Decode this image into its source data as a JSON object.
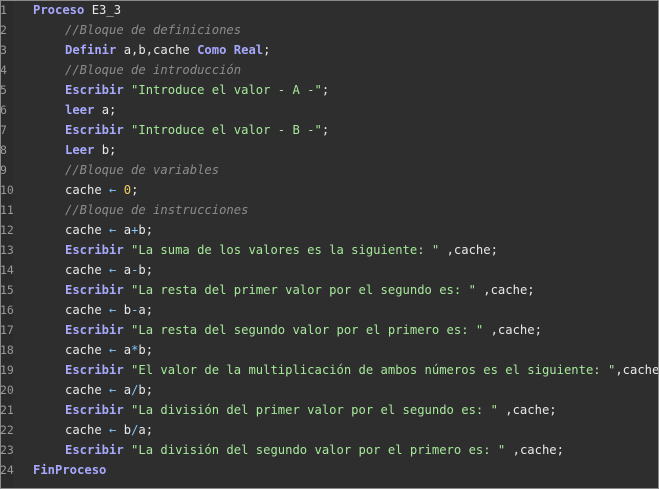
{
  "editor": {
    "lines": [
      {
        "n": "1",
        "indent": 0,
        "tokens": [
          {
            "t": "kw",
            "v": "Proceso"
          },
          {
            "t": "nm",
            "v": " E3_3"
          }
        ]
      },
      {
        "n": "2",
        "indent": 1,
        "tokens": [
          {
            "t": "cm",
            "v": "//Bloque de definiciones"
          }
        ]
      },
      {
        "n": "3",
        "indent": 1,
        "tokens": [
          {
            "t": "kw",
            "v": "Definir"
          },
          {
            "t": "nm",
            "v": " a,b,cache "
          },
          {
            "t": "kw",
            "v": "Como Real"
          },
          {
            "t": "pn",
            "v": ";"
          }
        ]
      },
      {
        "n": "4",
        "indent": 1,
        "tokens": [
          {
            "t": "cm",
            "v": "//Bloque de introducción"
          }
        ]
      },
      {
        "n": "5",
        "indent": 1,
        "tokens": [
          {
            "t": "kw",
            "v": "Escribir"
          },
          {
            "t": "nm",
            "v": " "
          },
          {
            "t": "st",
            "v": "\"Introduce el valor - A -\""
          },
          {
            "t": "pn",
            "v": ";"
          }
        ]
      },
      {
        "n": "6",
        "indent": 1,
        "tokens": [
          {
            "t": "kw",
            "v": "leer"
          },
          {
            "t": "nm",
            "v": " a;"
          }
        ]
      },
      {
        "n": "7",
        "indent": 1,
        "tokens": [
          {
            "t": "kw",
            "v": "Escribir"
          },
          {
            "t": "nm",
            "v": " "
          },
          {
            "t": "st",
            "v": "\"Introduce el valor - B -\""
          },
          {
            "t": "pn",
            "v": ";"
          }
        ]
      },
      {
        "n": "8",
        "indent": 1,
        "tokens": [
          {
            "t": "kw",
            "v": "Leer"
          },
          {
            "t": "nm",
            "v": " b;"
          }
        ]
      },
      {
        "n": "9",
        "indent": 1,
        "tokens": [
          {
            "t": "cm",
            "v": "//Bloque de variables"
          }
        ]
      },
      {
        "n": "10",
        "indent": 1,
        "tokens": [
          {
            "t": "nm",
            "v": "cache "
          },
          {
            "t": "op",
            "v": "←"
          },
          {
            "t": "nm",
            "v": " "
          },
          {
            "t": "nb",
            "v": "0"
          },
          {
            "t": "pn",
            "v": ";"
          }
        ]
      },
      {
        "n": "11",
        "indent": 1,
        "tokens": [
          {
            "t": "cm",
            "v": "//Bloque de instrucciones"
          }
        ]
      },
      {
        "n": "12",
        "indent": 1,
        "tokens": [
          {
            "t": "nm",
            "v": "cache "
          },
          {
            "t": "op",
            "v": "←"
          },
          {
            "t": "nm",
            "v": " a"
          },
          {
            "t": "op",
            "v": "+"
          },
          {
            "t": "nm",
            "v": "b;"
          }
        ]
      },
      {
        "n": "13",
        "indent": 1,
        "tokens": [
          {
            "t": "kw",
            "v": "Escribir"
          },
          {
            "t": "nm",
            "v": " "
          },
          {
            "t": "st",
            "v": "\"La suma de los valores es la siguiente: \""
          },
          {
            "t": "nm",
            "v": " ,cache;"
          }
        ]
      },
      {
        "n": "14",
        "indent": 1,
        "tokens": [
          {
            "t": "nm",
            "v": "cache "
          },
          {
            "t": "op",
            "v": "←"
          },
          {
            "t": "nm",
            "v": " a"
          },
          {
            "t": "op",
            "v": "-"
          },
          {
            "t": "nm",
            "v": "b;"
          }
        ]
      },
      {
        "n": "15",
        "indent": 1,
        "tokens": [
          {
            "t": "kw",
            "v": "Escribir"
          },
          {
            "t": "nm",
            "v": " "
          },
          {
            "t": "st",
            "v": "\"La resta del primer valor por el segundo es: \""
          },
          {
            "t": "nm",
            "v": " ,cache;"
          }
        ]
      },
      {
        "n": "16",
        "indent": 1,
        "tokens": [
          {
            "t": "nm",
            "v": "cache "
          },
          {
            "t": "op",
            "v": "←"
          },
          {
            "t": "nm",
            "v": " b"
          },
          {
            "t": "op",
            "v": "-"
          },
          {
            "t": "nm",
            "v": "a;"
          }
        ]
      },
      {
        "n": "17",
        "indent": 1,
        "tokens": [
          {
            "t": "kw",
            "v": "Escribir"
          },
          {
            "t": "nm",
            "v": " "
          },
          {
            "t": "st",
            "v": "\"La resta del segundo valor por el primero es: \""
          },
          {
            "t": "nm",
            "v": " ,cache;"
          }
        ]
      },
      {
        "n": "18",
        "indent": 1,
        "tokens": [
          {
            "t": "nm",
            "v": "cache "
          },
          {
            "t": "op",
            "v": "←"
          },
          {
            "t": "nm",
            "v": " a"
          },
          {
            "t": "op",
            "v": "*"
          },
          {
            "t": "nm",
            "v": "b;"
          }
        ]
      },
      {
        "n": "19",
        "indent": 1,
        "tokens": [
          {
            "t": "kw",
            "v": "Escribir"
          },
          {
            "t": "nm",
            "v": " "
          },
          {
            "t": "st",
            "v": "\"El valor de la multiplicación de ambos números es el siguiente: \""
          },
          {
            "t": "nm",
            "v": ",cache;"
          }
        ]
      },
      {
        "n": "20",
        "indent": 1,
        "tokens": [
          {
            "t": "nm",
            "v": "cache "
          },
          {
            "t": "op",
            "v": "←"
          },
          {
            "t": "nm",
            "v": " a"
          },
          {
            "t": "op",
            "v": "/"
          },
          {
            "t": "nm",
            "v": "b;"
          }
        ]
      },
      {
        "n": "21",
        "indent": 1,
        "tokens": [
          {
            "t": "kw",
            "v": "Escribir"
          },
          {
            "t": "nm",
            "v": " "
          },
          {
            "t": "st",
            "v": "\"La división del primer valor por el segundo es: \""
          },
          {
            "t": "nm",
            "v": " ,cache;"
          }
        ]
      },
      {
        "n": "22",
        "indent": 1,
        "tokens": [
          {
            "t": "nm",
            "v": "cache "
          },
          {
            "t": "op",
            "v": "←"
          },
          {
            "t": "nm",
            "v": " b"
          },
          {
            "t": "op",
            "v": "/"
          },
          {
            "t": "nm",
            "v": "a;"
          }
        ]
      },
      {
        "n": "23",
        "indent": 1,
        "tokens": [
          {
            "t": "kw",
            "v": "Escribir"
          },
          {
            "t": "nm",
            "v": " "
          },
          {
            "t": "st",
            "v": "\"La división del segundo valor por el primero es: \""
          },
          {
            "t": "nm",
            "v": " ,cache;"
          }
        ]
      },
      {
        "n": "24",
        "indent": 0,
        "tokens": [
          {
            "t": "kw",
            "v": "FinProceso"
          }
        ]
      }
    ]
  },
  "colors": {
    "background": "#2e2e2e",
    "keyword": "#a8a8ff",
    "comment": "#8c8c8c",
    "string": "#a6e89a",
    "number": "#f0d060",
    "operator": "#7ec8ff",
    "text": "#e8e8e8",
    "line_number": "#9a9a9a"
  }
}
